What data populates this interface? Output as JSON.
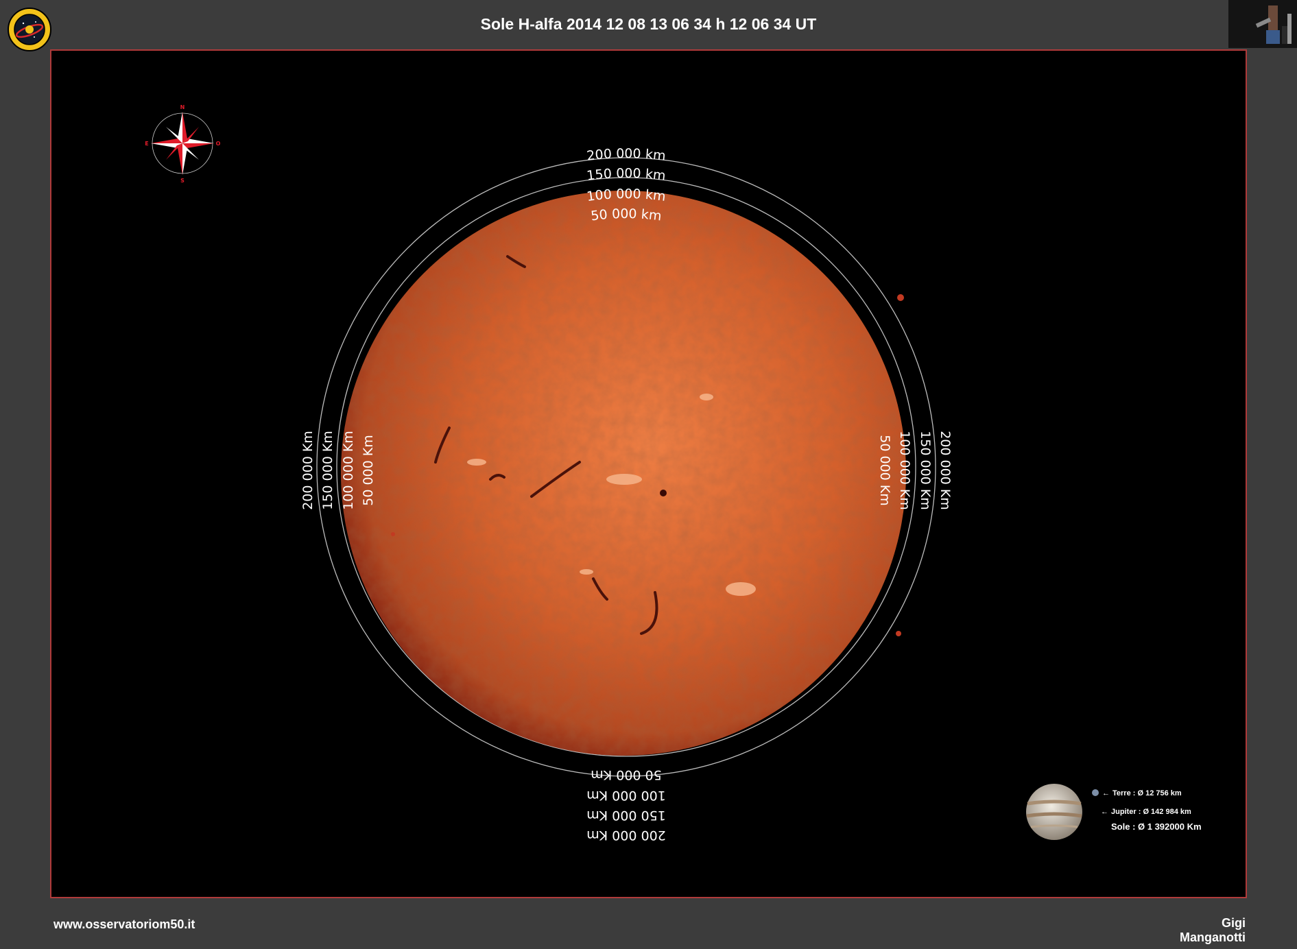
{
  "header": {
    "title": "Sole H-alfa 2014 12 08 13 06 34 h 12 06 34 UT"
  },
  "compass": {
    "north": "N",
    "south": "S",
    "east": "E",
    "west": "O"
  },
  "rings": {
    "top": [
      "200 000 km",
      "150 000 km",
      "100 000 km",
      "50 000 km"
    ],
    "left": [
      "200 000 Km",
      "150 000 Km",
      "100 000 Km",
      "50 000 Km"
    ],
    "right": [
      "50 000 Km",
      "100 000 Km",
      "150 000 Km",
      "200 000 Km"
    ],
    "bottom": [
      "50 000 Km",
      "100 000 Km",
      "150 000 Km",
      "200 000 Km"
    ]
  },
  "scale_legend": {
    "earth": "Terre : Ø 12 756 km",
    "jupiter": "Jupiter : Ø 142 984 km",
    "sun": "Sole : Ø 1 392000 Km"
  },
  "footer": {
    "website": "www.osservatoriom50.it",
    "author": "Gigi Manganotti"
  },
  "colors": {
    "frame_border": "#b03a3a",
    "sun_core": "#e8743a",
    "sun_limb": "#7a1c10",
    "compass": "#e01c2a"
  }
}
